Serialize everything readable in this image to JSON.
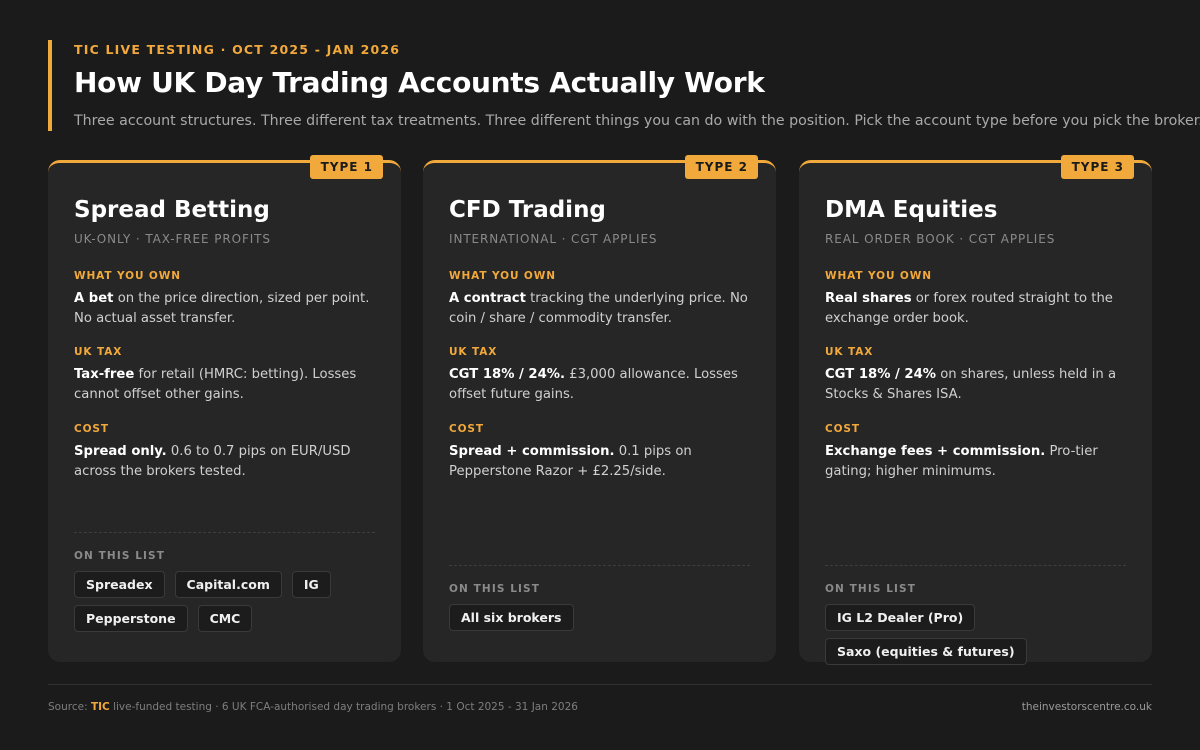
{
  "header": {
    "eyebrow": "TIC LIVE TESTING · OCT 2025 - JAN 2026",
    "title": "How UK Day Trading Accounts Actually Work",
    "subtitle": "Three account structures. Three different tax treatments. Three different things you can do with the position. Pick the account type before you pick the broker."
  },
  "labels": {
    "what_you_own": "WHAT YOU OWN",
    "uk_tax": "UK TAX",
    "cost": "COST",
    "on_this_list": "ON THIS LIST"
  },
  "cards": [
    {
      "badge": "TYPE 1",
      "title": "Spread Betting",
      "subtitle": "UK-ONLY · TAX-FREE PROFITS",
      "own_bold": "A bet",
      "own_rest": " on the price direction, sized per point. No actual asset transfer.",
      "tax_bold": "Tax-free",
      "tax_rest": " for retail (HMRC: betting). Losses cannot offset other gains.",
      "cost_bold": "Spread only.",
      "cost_rest": " 0.6 to 0.7 pips on EUR/USD across the brokers tested.",
      "brokers": [
        "Spreadex",
        "Capital.com",
        "IG",
        "Pepperstone",
        "CMC"
      ]
    },
    {
      "badge": "TYPE 2",
      "title": "CFD Trading",
      "subtitle": "INTERNATIONAL · CGT APPLIES",
      "own_bold": "A contract",
      "own_rest": " tracking the underlying price. No coin / share / commodity transfer.",
      "tax_bold": "CGT 18% / 24%.",
      "tax_rest": " £3,000 allowance. Losses offset future gains.",
      "cost_bold": "Spread + commission.",
      "cost_rest": " 0.1 pips on Pepperstone Razor + £2.25/side.",
      "brokers": [
        "All six brokers"
      ]
    },
    {
      "badge": "TYPE 3",
      "title": "DMA Equities",
      "subtitle": "REAL ORDER BOOK · CGT APPLIES",
      "own_bold": "Real shares",
      "own_rest": " or forex routed straight to the exchange order book.",
      "tax_bold": "CGT 18% / 24%",
      "tax_rest": " on shares, unless held in a Stocks & Shares ISA.",
      "cost_bold": "Exchange fees + commission.",
      "cost_rest": " Pro-tier gating; higher minimums.",
      "brokers": [
        "IG L2 Dealer (Pro)",
        "Saxo (equities & futures)"
      ]
    }
  ],
  "footer": {
    "source_prefix": "Source: ",
    "brand": "TIC",
    "source_rest": " live-funded testing · 6 UK FCA-authorised day trading brokers · 1 Oct 2025 - 31 Jan 2026",
    "site": "theinvestorscentre.co.uk"
  },
  "colors": {
    "accent": "#f2a93b",
    "background": "#1b1b1b",
    "card": "#262626"
  }
}
